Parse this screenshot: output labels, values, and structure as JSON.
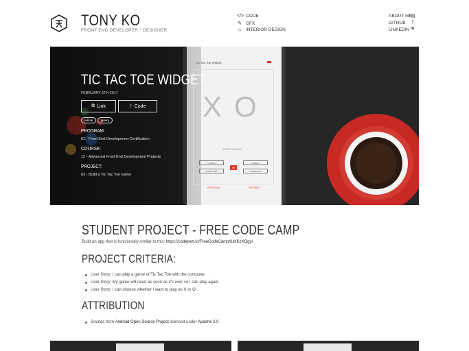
{
  "header": {
    "name": "TONY KO",
    "subtitle": "FRONT END DEVELOPER * DESIGNER",
    "nav_center": [
      {
        "label": "CODE",
        "icon": "code-icon"
      },
      {
        "label": "GFX",
        "icon": "brush-icon"
      },
      {
        "label": "INTERIOR DESIGN",
        "icon": "building-icon"
      }
    ],
    "nav_right": [
      {
        "label": "ABOUT ME",
        "icon": "id-card-icon"
      },
      {
        "label": "GITHUB",
        "icon": "git-icon"
      },
      {
        "label": "LINKEDIN",
        "icon": "linkedin-icon"
      }
    ]
  },
  "hero": {
    "title": "TIC TAC TOE WIDGET",
    "date": "FEBRUARY 5TH 2017",
    "buttons": {
      "link": "Link",
      "code": "Code"
    },
    "tags": [
      "bulmar",
      "jquery"
    ],
    "program_label": "PROGRAM:",
    "program_value": "01 - Front End Development Certification",
    "course_label": "COURSE:",
    "course_value": "12 - Advanced Front End Development Projects",
    "project_label": "PROJECT:",
    "project_value": "03 - Build a Tic Tac Toe Game",
    "phone": {
      "app_title": "Tic Tac Toe Widget",
      "x_mark": "X",
      "o_mark": "O",
      "status": "SELECT PLAYER",
      "opt1": "HUMAN",
      "opt2": "HUMAN",
      "vs": "VS",
      "opt3": "COMPUTER",
      "opt4": "COMPUTER",
      "footer_left": "PREVIOUS",
      "footer_right": "RESTART"
    }
  },
  "content": {
    "heading1": "STUDENT PROJECT - FREE CODE CAMP",
    "para_prefix": "Build an app that is functionally similar to this: ",
    "para_link": "https://codepen.io/FreeCodeCamp/full/KzXQgy/",
    "para_suffix": ".",
    "heading2": "PROJECT CRITERIA:",
    "criteria": [
      "User Story: I can play a game of Tic Tac Toe with the computer.",
      "User Story: My game will reset as soon as it's over so I can play again.",
      "User Story: I can choose whether I want to play as X or O."
    ],
    "heading3": "ATTRIBUTION",
    "attr_prefix": "Sounds from ",
    "attr_link1": "Android Open Source Project",
    "attr_mid": " licensed under ",
    "attr_link2": "Apache 2.0"
  },
  "colors": {
    "text": "#333333",
    "hero_dark": "#232323",
    "accent_red": "#e03a2f"
  }
}
